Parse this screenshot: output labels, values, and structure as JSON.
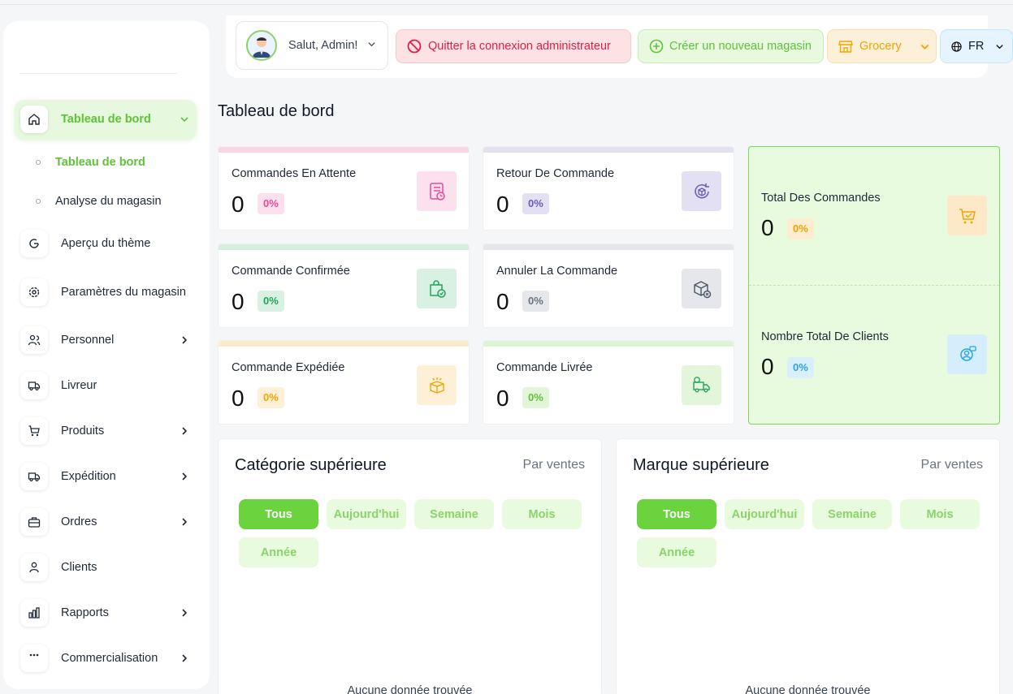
{
  "header": {
    "greeting": "Salut, Admin!",
    "quit_label": "Quitter la connexion administrateur",
    "create_label": "Créer un nouveau magasin",
    "store_label": "Grocery",
    "lang_label": "FR"
  },
  "sidebar": {
    "items": [
      {
        "label": "Tableau de bord",
        "icon": "home-icon"
      },
      {
        "label": "Aperçu du thème",
        "icon": "theme-icon"
      },
      {
        "label": "Paramètres du magasin",
        "icon": "settings-icon"
      },
      {
        "label": "Personnel",
        "icon": "users-icon"
      },
      {
        "label": "Livreur",
        "icon": "truck-icon"
      },
      {
        "label": "Produits",
        "icon": "cart-icon"
      },
      {
        "label": "Expédition",
        "icon": "shipping-icon"
      },
      {
        "label": "Ordres",
        "icon": "briefcase-icon"
      },
      {
        "label": "Clients",
        "icon": "user-icon"
      },
      {
        "label": "Rapports",
        "icon": "chart-icon"
      },
      {
        "label": "Commercialisation",
        "icon": "grid-icon"
      }
    ],
    "subitems": [
      {
        "label": "Tableau de bord"
      },
      {
        "label": "Analyse du magasin"
      }
    ]
  },
  "page": {
    "title": "Tableau de bord"
  },
  "stats": [
    {
      "label": "Commandes En Attente",
      "value": "0",
      "pct": "0%",
      "color": "#ec4899"
    },
    {
      "label": "Retour De Commande",
      "value": "0",
      "pct": "0%",
      "color": "#6d5bb8"
    },
    {
      "label": "Commande Confirmée",
      "value": "0",
      "pct": "0%",
      "color": "#22a55b"
    },
    {
      "label": "Annuler La Commande",
      "value": "0",
      "pct": "0%",
      "color": "#6b7280"
    },
    {
      "label": "Commande Expédiée",
      "value": "0",
      "pct": "0%",
      "color": "#f0a500"
    },
    {
      "label": "Commande Livrée",
      "value": "0",
      "pct": "0%",
      "color": "#5fc23a"
    }
  ],
  "totals": [
    {
      "label": "Total Des Commandes",
      "value": "0",
      "pct": "0%"
    },
    {
      "label": "Nombre Total De Clients",
      "value": "0",
      "pct": "0%"
    }
  ],
  "panels": [
    {
      "title": "Catégorie supérieure",
      "subtitle": "Par ventes",
      "empty": "Aucune donnée trouvée"
    },
    {
      "title": "Marque supérieure",
      "subtitle": "Par ventes",
      "empty": "Aucune donnée trouvée"
    }
  ],
  "filters": [
    "Tous",
    "Aujourd'hui",
    "Semaine",
    "Mois",
    "Année"
  ]
}
